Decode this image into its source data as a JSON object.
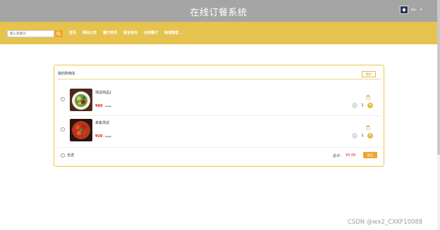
{
  "header": {
    "title": "在线订餐系统",
    "user_name": "aa"
  },
  "nav": {
    "search_placeholder": "输入关键词",
    "items": [
      {
        "label": "首页"
      },
      {
        "label": "网站公告"
      },
      {
        "label": "餐厅资讯"
      },
      {
        "label": "留言板块"
      },
      {
        "label": "在线餐厅"
      },
      {
        "label": "商城管理"
      }
    ]
  },
  "cart": {
    "title": "我的购物车",
    "delete_label": "删除",
    "items": [
      {
        "name": "测试商品1",
        "price": "¥99",
        "original_price": "¥100",
        "quantity": "1"
      },
      {
        "name": "来客测试",
        "price": "¥20",
        "original_price": "¥100",
        "quantity": "1"
      }
    ],
    "select_all_label": "全选",
    "total_label": "总计:",
    "total_value": "¥0.00",
    "checkout_label": "购买"
  },
  "watermark": "CSDN @wx2_CXKF10088",
  "colors": {
    "header_bg": "#a5a5a5",
    "nav_bg": "#e6c34f",
    "accent": "#f0a72a",
    "price_red": "#e0211b"
  }
}
